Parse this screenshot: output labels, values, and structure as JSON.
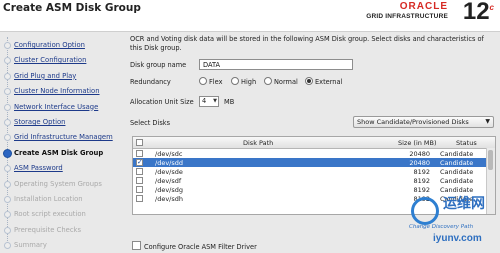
{
  "header": {
    "title": "Create ASM Disk Group",
    "brand": "ORACLE",
    "product": "GRID INFRASTRUCTURE",
    "version": "12",
    "version_suffix": "c"
  },
  "sidebar": {
    "steps": [
      {
        "label": "Configuration Option",
        "state": "done"
      },
      {
        "label": "Cluster Configuration",
        "state": "done"
      },
      {
        "label": "Grid Plug and Play",
        "state": "done"
      },
      {
        "label": "Cluster Node Information",
        "state": "done"
      },
      {
        "label": "Network Interface Usage",
        "state": "done"
      },
      {
        "label": "Storage Option",
        "state": "done"
      },
      {
        "label": "Grid Infrastructure Managem",
        "state": "done"
      },
      {
        "label": "Create ASM Disk Group",
        "state": "current"
      },
      {
        "label": "ASM Password",
        "state": "next"
      },
      {
        "label": "Operating System Groups",
        "state": "future"
      },
      {
        "label": "Installation Location",
        "state": "future"
      },
      {
        "label": "Root script execution",
        "state": "future"
      },
      {
        "label": "Prerequisite Checks",
        "state": "future"
      },
      {
        "label": "Summary",
        "state": "future"
      }
    ]
  },
  "main": {
    "description": "OCR and Voting disk data will be stored in the following ASM Disk group. Select disks and characteristics of this Disk group.",
    "disk_group_label": "Disk group name",
    "disk_group_value": "DATA",
    "redundancy_label": "Redundancy",
    "redundancy_options": [
      "Flex",
      "High",
      "Normal",
      "External"
    ],
    "redundancy_selected": "External",
    "allocation_label": "Allocation Unit Size",
    "allocation_value": "4",
    "allocation_unit": "MB",
    "select_disks_label": "Select Disks",
    "filter_value": "Show Candidate/Provisioned Disks",
    "table": {
      "columns": [
        "Disk Path",
        "Size (in MB)",
        "Status"
      ],
      "rows": [
        {
          "checked": false,
          "path": "/dev/sdc",
          "size": "20480",
          "status": "Candidate",
          "selected": false
        },
        {
          "checked": true,
          "path": "/dev/sdd",
          "size": "20480",
          "status": "Candidate",
          "selected": true
        },
        {
          "checked": false,
          "path": "/dev/sde",
          "size": "8192",
          "status": "Candidate",
          "selected": false
        },
        {
          "checked": false,
          "path": "/dev/sdf",
          "size": "8192",
          "status": "Candidate",
          "selected": false
        },
        {
          "checked": false,
          "path": "/dev/sdg",
          "size": "8192",
          "status": "Candidate",
          "selected": false
        },
        {
          "checked": false,
          "path": "/dev/sdh",
          "size": "8192",
          "status": "Candidate",
          "selected": false
        }
      ]
    },
    "bottom_checkbox": "Configure Oracle ASM Filter Driver"
  },
  "watermark": {
    "cn": "运维网",
    "tagline": "Change Discovery Path",
    "url": "iyunv.com"
  },
  "colors": {
    "accent": "#2b65c1",
    "selected_row": "#3a76c8",
    "oracle_red": "#d62a24"
  }
}
